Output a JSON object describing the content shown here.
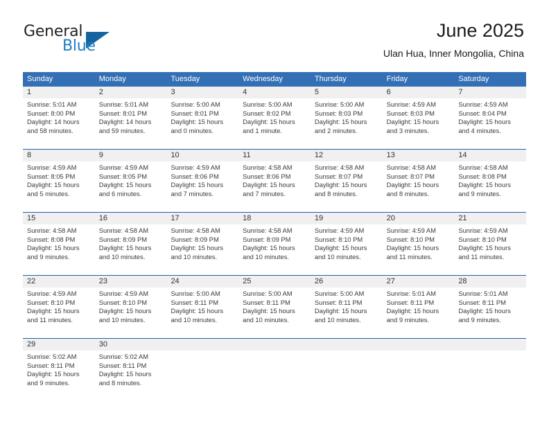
{
  "brand": {
    "name_top": "General",
    "name_bottom": "Blue",
    "accent_color": "#15639f",
    "blue_text_color": "#1d7fc4"
  },
  "header": {
    "title": "June 2025",
    "subtitle": "Ulan Hua, Inner Mongolia, China"
  },
  "theme": {
    "header_row_bg": "#336fb5",
    "row_separator": "#1f5fa8",
    "daynum_bg": "#f0f0f0",
    "text_color": "#3a3a3a"
  },
  "calendar": {
    "weekdays": [
      "Sunday",
      "Monday",
      "Tuesday",
      "Wednesday",
      "Thursday",
      "Friday",
      "Saturday"
    ],
    "weeks": [
      [
        {
          "day": "1",
          "sunrise": "Sunrise: 5:01 AM",
          "sunset": "Sunset: 8:00 PM",
          "daylight": "Daylight: 14 hours and 58 minutes."
        },
        {
          "day": "2",
          "sunrise": "Sunrise: 5:01 AM",
          "sunset": "Sunset: 8:01 PM",
          "daylight": "Daylight: 14 hours and 59 minutes."
        },
        {
          "day": "3",
          "sunrise": "Sunrise: 5:00 AM",
          "sunset": "Sunset: 8:01 PM",
          "daylight": "Daylight: 15 hours and 0 minutes."
        },
        {
          "day": "4",
          "sunrise": "Sunrise: 5:00 AM",
          "sunset": "Sunset: 8:02 PM",
          "daylight": "Daylight: 15 hours and 1 minute."
        },
        {
          "day": "5",
          "sunrise": "Sunrise: 5:00 AM",
          "sunset": "Sunset: 8:03 PM",
          "daylight": "Daylight: 15 hours and 2 minutes."
        },
        {
          "day": "6",
          "sunrise": "Sunrise: 4:59 AM",
          "sunset": "Sunset: 8:03 PM",
          "daylight": "Daylight: 15 hours and 3 minutes."
        },
        {
          "day": "7",
          "sunrise": "Sunrise: 4:59 AM",
          "sunset": "Sunset: 8:04 PM",
          "daylight": "Daylight: 15 hours and 4 minutes."
        }
      ],
      [
        {
          "day": "8",
          "sunrise": "Sunrise: 4:59 AM",
          "sunset": "Sunset: 8:05 PM",
          "daylight": "Daylight: 15 hours and 5 minutes."
        },
        {
          "day": "9",
          "sunrise": "Sunrise: 4:59 AM",
          "sunset": "Sunset: 8:05 PM",
          "daylight": "Daylight: 15 hours and 6 minutes."
        },
        {
          "day": "10",
          "sunrise": "Sunrise: 4:59 AM",
          "sunset": "Sunset: 8:06 PM",
          "daylight": "Daylight: 15 hours and 7 minutes."
        },
        {
          "day": "11",
          "sunrise": "Sunrise: 4:58 AM",
          "sunset": "Sunset: 8:06 PM",
          "daylight": "Daylight: 15 hours and 7 minutes."
        },
        {
          "day": "12",
          "sunrise": "Sunrise: 4:58 AM",
          "sunset": "Sunset: 8:07 PM",
          "daylight": "Daylight: 15 hours and 8 minutes."
        },
        {
          "day": "13",
          "sunrise": "Sunrise: 4:58 AM",
          "sunset": "Sunset: 8:07 PM",
          "daylight": "Daylight: 15 hours and 8 minutes."
        },
        {
          "day": "14",
          "sunrise": "Sunrise: 4:58 AM",
          "sunset": "Sunset: 8:08 PM",
          "daylight": "Daylight: 15 hours and 9 minutes."
        }
      ],
      [
        {
          "day": "15",
          "sunrise": "Sunrise: 4:58 AM",
          "sunset": "Sunset: 8:08 PM",
          "daylight": "Daylight: 15 hours and 9 minutes."
        },
        {
          "day": "16",
          "sunrise": "Sunrise: 4:58 AM",
          "sunset": "Sunset: 8:09 PM",
          "daylight": "Daylight: 15 hours and 10 minutes."
        },
        {
          "day": "17",
          "sunrise": "Sunrise: 4:58 AM",
          "sunset": "Sunset: 8:09 PM",
          "daylight": "Daylight: 15 hours and 10 minutes."
        },
        {
          "day": "18",
          "sunrise": "Sunrise: 4:58 AM",
          "sunset": "Sunset: 8:09 PM",
          "daylight": "Daylight: 15 hours and 10 minutes."
        },
        {
          "day": "19",
          "sunrise": "Sunrise: 4:59 AM",
          "sunset": "Sunset: 8:10 PM",
          "daylight": "Daylight: 15 hours and 10 minutes."
        },
        {
          "day": "20",
          "sunrise": "Sunrise: 4:59 AM",
          "sunset": "Sunset: 8:10 PM",
          "daylight": "Daylight: 15 hours and 11 minutes."
        },
        {
          "day": "21",
          "sunrise": "Sunrise: 4:59 AM",
          "sunset": "Sunset: 8:10 PM",
          "daylight": "Daylight: 15 hours and 11 minutes."
        }
      ],
      [
        {
          "day": "22",
          "sunrise": "Sunrise: 4:59 AM",
          "sunset": "Sunset: 8:10 PM",
          "daylight": "Daylight: 15 hours and 11 minutes."
        },
        {
          "day": "23",
          "sunrise": "Sunrise: 4:59 AM",
          "sunset": "Sunset: 8:10 PM",
          "daylight": "Daylight: 15 hours and 10 minutes."
        },
        {
          "day": "24",
          "sunrise": "Sunrise: 5:00 AM",
          "sunset": "Sunset: 8:11 PM",
          "daylight": "Daylight: 15 hours and 10 minutes."
        },
        {
          "day": "25",
          "sunrise": "Sunrise: 5:00 AM",
          "sunset": "Sunset: 8:11 PM",
          "daylight": "Daylight: 15 hours and 10 minutes."
        },
        {
          "day": "26",
          "sunrise": "Sunrise: 5:00 AM",
          "sunset": "Sunset: 8:11 PM",
          "daylight": "Daylight: 15 hours and 10 minutes."
        },
        {
          "day": "27",
          "sunrise": "Sunrise: 5:01 AM",
          "sunset": "Sunset: 8:11 PM",
          "daylight": "Daylight: 15 hours and 9 minutes."
        },
        {
          "day": "28",
          "sunrise": "Sunrise: 5:01 AM",
          "sunset": "Sunset: 8:11 PM",
          "daylight": "Daylight: 15 hours and 9 minutes."
        }
      ],
      [
        {
          "day": "29",
          "sunrise": "Sunrise: 5:02 AM",
          "sunset": "Sunset: 8:11 PM",
          "daylight": "Daylight: 15 hours and 9 minutes."
        },
        {
          "day": "30",
          "sunrise": "Sunrise: 5:02 AM",
          "sunset": "Sunset: 8:11 PM",
          "daylight": "Daylight: 15 hours and 8 minutes."
        },
        {
          "day": "",
          "sunrise": "",
          "sunset": "",
          "daylight": ""
        },
        {
          "day": "",
          "sunrise": "",
          "sunset": "",
          "daylight": ""
        },
        {
          "day": "",
          "sunrise": "",
          "sunset": "",
          "daylight": ""
        },
        {
          "day": "",
          "sunrise": "",
          "sunset": "",
          "daylight": ""
        },
        {
          "day": "",
          "sunrise": "",
          "sunset": "",
          "daylight": ""
        }
      ]
    ]
  }
}
